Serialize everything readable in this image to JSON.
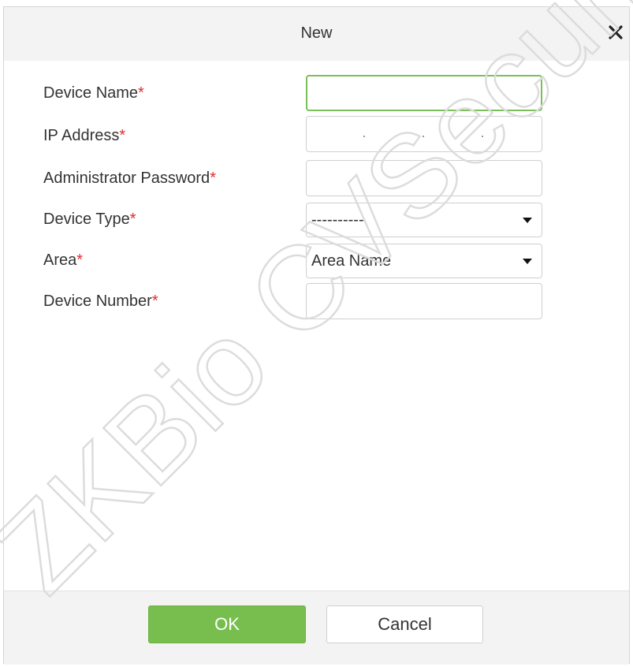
{
  "dialog": {
    "title": "New",
    "close_icon": "close-icon"
  },
  "form": {
    "fields": [
      {
        "label": "Device Name",
        "required_mark": "*",
        "type": "text",
        "value": ""
      },
      {
        "label": "IP Address",
        "required_mark": "*",
        "type": "ip",
        "value": ""
      },
      {
        "label": "Administrator Password",
        "required_mark": "*",
        "type": "password",
        "value": ""
      },
      {
        "label": "Device Type",
        "required_mark": "*",
        "type": "select",
        "value": "----------"
      },
      {
        "label": "Area",
        "required_mark": "*",
        "type": "select",
        "value": "Area Name"
      },
      {
        "label": "Device Number",
        "required_mark": "*",
        "type": "text",
        "value": ""
      }
    ]
  },
  "footer": {
    "ok_label": "OK",
    "cancel_label": "Cancel"
  },
  "watermark": {
    "text": "ZKBio CVSecurity"
  },
  "colors": {
    "ok_button": "#78be4f",
    "required": "#e02b2b",
    "active_border": "#7bbf5a",
    "titlebar": "#f3f3f3"
  }
}
